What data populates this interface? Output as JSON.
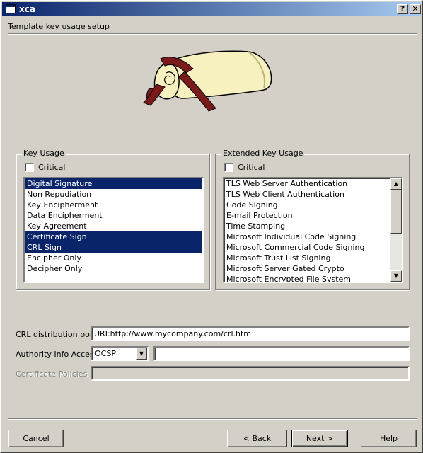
{
  "window": {
    "title": "xca",
    "help_glyph": "?",
    "close_glyph": "✕"
  },
  "page": {
    "title": "Template key usage setup"
  },
  "key_usage": {
    "group_title": "Key Usage",
    "critical_label": "Critical",
    "critical_checked": false,
    "items": [
      {
        "label": "Digital Signature",
        "selected": true
      },
      {
        "label": "Non Repudiation",
        "selected": false
      },
      {
        "label": "Key Encipherment",
        "selected": false
      },
      {
        "label": "Data Encipherment",
        "selected": false
      },
      {
        "label": "Key Agreement",
        "selected": false
      },
      {
        "label": "Certificate Sign",
        "selected": true
      },
      {
        "label": "CRL Sign",
        "selected": true
      },
      {
        "label": "Encipher Only",
        "selected": false
      },
      {
        "label": "Decipher Only",
        "selected": false
      }
    ]
  },
  "extended_key_usage": {
    "group_title": "Extended Key Usage",
    "critical_label": "Critical",
    "critical_checked": false,
    "items": [
      {
        "label": "TLS Web Server Authentication"
      },
      {
        "label": "TLS Web Client Authentication"
      },
      {
        "label": "Code Signing"
      },
      {
        "label": "E-mail Protection"
      },
      {
        "label": "Time Stamping"
      },
      {
        "label": "Microsoft Individual Code Signing"
      },
      {
        "label": "Microsoft Commercial Code Signing"
      },
      {
        "label": "Microsoft Trust List Signing"
      },
      {
        "label": "Microsoft Server Gated Crypto"
      },
      {
        "label": "Microsoft Encrypted File System"
      }
    ]
  },
  "form": {
    "crl_label": "CRL distribution point",
    "crl_value": "URI:http://www.mycompany.com/crl.htm",
    "aia_label": "Authority Info Access",
    "aia_method": "OCSP",
    "aia_value": "",
    "policies_label": "Certificate Policies",
    "policies_value": ""
  },
  "buttons": {
    "cancel": "Cancel",
    "back": "< Back",
    "next": "Next >",
    "help": "Help"
  },
  "colors": {
    "face": "#d4d0c8",
    "selection": "#0a246a",
    "titlebar_start": "#0a246a",
    "titlebar_end": "#a6caf0",
    "scroll_paper": "#f7f1c0",
    "scroll_ribbon": "#7a1a1a"
  }
}
